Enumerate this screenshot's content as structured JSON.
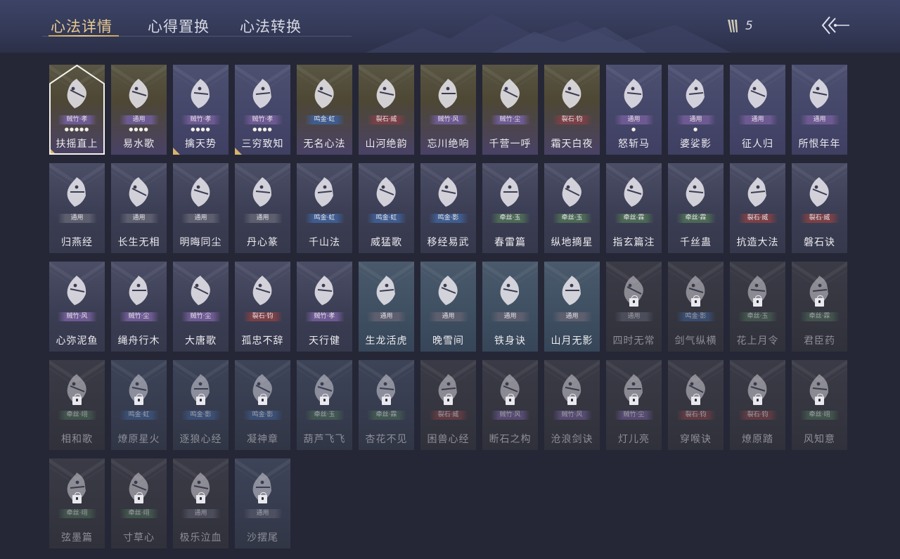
{
  "tabs": [
    {
      "label": "心法详情",
      "active": true
    },
    {
      "label": "心得置换",
      "active": false
    },
    {
      "label": "心法转换",
      "active": false
    }
  ],
  "currency": {
    "icon": "feather-token-icon",
    "value": "5"
  },
  "back_button": {
    "icon": "back-arrow-icon"
  },
  "colors": {
    "active_tab": "#e9c98f",
    "background": "#252737",
    "header": "#3d4366"
  },
  "cards": [
    {
      "name": "扶摇直上",
      "badge": "贼竹·孝",
      "badge_color": "purple",
      "stars": 5,
      "style": "gold",
      "icon": "eagle-icon",
      "selected": true,
      "corner": true
    },
    {
      "name": "易水歌",
      "badge": "通用",
      "badge_color": "purple",
      "stars": 4,
      "style": "gold",
      "icon": "horse-icon"
    },
    {
      "name": "擒天势",
      "badge": "贼竹·孝",
      "badge_color": "purple",
      "stars": 4,
      "style": "purple",
      "icon": "chained-fist-icon",
      "corner": true
    },
    {
      "name": "三穷致知",
      "badge": "贼竹·孝",
      "badge_color": "purple",
      "stars": 4,
      "style": "purple",
      "icon": "scroll-icon",
      "corner": true
    },
    {
      "name": "无名心法",
      "badge": "鸣金·虹",
      "badge_color": "blue",
      "style": "gold",
      "icon": "sword-icon"
    },
    {
      "name": "山河绝韵",
      "badge": "裂石·威",
      "badge_color": "red",
      "style": "gold",
      "icon": "mountains-icon"
    },
    {
      "name": "忘川绝响",
      "badge": "贼竹·风",
      "badge_color": "purple",
      "style": "gold",
      "icon": "mask-icon"
    },
    {
      "name": "千营一呼",
      "badge": "贼竹·尘",
      "badge_color": "purple",
      "style": "gold",
      "icon": "flag-icon"
    },
    {
      "name": "霜天白夜",
      "badge": "裂石·钧",
      "badge_color": "red",
      "style": "gold",
      "icon": "blade-icon"
    },
    {
      "name": "怒斩马",
      "badge": "通用",
      "badge_color": "purple",
      "stars": 1,
      "style": "purple",
      "icon": "crossed-blades-icon"
    },
    {
      "name": "婆娑影",
      "badge": "通用",
      "badge_color": "purple",
      "stars": 1,
      "style": "purple",
      "icon": "dragon-icon"
    },
    {
      "name": "征人归",
      "badge": "通用",
      "badge_color": "purple",
      "style": "purple",
      "icon": "hand-bird-icon"
    },
    {
      "name": "所恨年年",
      "badge": "通用",
      "badge_color": "purple",
      "style": "purple",
      "icon": "bamboo-icon"
    },
    {
      "name": "归燕经",
      "badge": "通用",
      "badge_color": "grey",
      "style": "normal",
      "icon": "swallows-icon"
    },
    {
      "name": "长生无相",
      "badge": "通用",
      "badge_color": "grey",
      "style": "normal",
      "icon": "figure-icon"
    },
    {
      "name": "明晦同尘",
      "badge": "通用",
      "badge_color": "grey",
      "style": "normal",
      "icon": "serpent-icon"
    },
    {
      "name": "丹心篆",
      "badge": "通用",
      "badge_color": "grey",
      "style": "normal",
      "icon": "brush-icon"
    },
    {
      "name": "千山法",
      "badge": "鸣金·虹",
      "badge_color": "blue",
      "style": "normal",
      "icon": "peaks-icon"
    },
    {
      "name": "威猛歌",
      "badge": "鸣金·虹",
      "badge_color": "blue",
      "style": "normal",
      "icon": "prayer-hands-icon"
    },
    {
      "name": "移经易武",
      "badge": "鸣金·影",
      "badge_color": "blue",
      "style": "normal",
      "icon": "armor-icon"
    },
    {
      "name": "春雷篇",
      "badge": "牵丝·玉",
      "badge_color": "green",
      "style": "normal",
      "icon": "storm-tree-icon"
    },
    {
      "name": "纵地摘星",
      "badge": "牵丝·玉",
      "badge_color": "green",
      "style": "normal",
      "icon": "orbit-icon"
    },
    {
      "name": "指玄篇注",
      "badge": "牵丝·霖",
      "badge_color": "green",
      "style": "normal",
      "icon": "yin-yang-icon"
    },
    {
      "name": "千丝蛊",
      "badge": "牵丝·霖",
      "badge_color": "green",
      "style": "normal",
      "icon": "leaf-icon"
    },
    {
      "name": "抗造大法",
      "badge": "裂石·威",
      "badge_color": "red",
      "style": "normal",
      "icon": "bell-icon"
    },
    {
      "name": "磐石诀",
      "badge": "裂石·威",
      "badge_color": "red",
      "style": "normal",
      "icon": "rock-icon"
    },
    {
      "name": "心弥泥鱼",
      "badge": "贼竹·风",
      "badge_color": "purple",
      "style": "normal",
      "icon": "fish-icon"
    },
    {
      "name": "绳舟行木",
      "badge": "贼竹·尘",
      "badge_color": "purple",
      "style": "normal",
      "icon": "roots-icon"
    },
    {
      "name": "大唐歌",
      "badge": "贼竹·尘",
      "badge_color": "purple",
      "style": "normal",
      "icon": "palace-icon"
    },
    {
      "name": "孤忠不辞",
      "badge": "裂石·钧",
      "badge_color": "red",
      "style": "normal",
      "icon": "spear-icon"
    },
    {
      "name": "天行健",
      "badge": "贼竹·孝",
      "badge_color": "purple",
      "style": "normal",
      "icon": "lightning-icon"
    },
    {
      "name": "生龙活虎",
      "badge": "通用",
      "badge_color": "grey",
      "style": "teal",
      "icon": "spiral-cross-icon"
    },
    {
      "name": "晚雪间",
      "badge": "通用",
      "badge_color": "grey",
      "style": "teal",
      "icon": "anchor-cross-icon"
    },
    {
      "name": "铁身诀",
      "badge": "通用",
      "badge_color": "grey",
      "style": "teal",
      "icon": "strongman-icon"
    },
    {
      "name": "山月无影",
      "badge": "通用",
      "badge_color": "grey",
      "style": "teal",
      "icon": "claw-icon"
    },
    {
      "name": "四时无常",
      "badge": "通用",
      "badge_color": "grey",
      "style": "dim",
      "icon": "beast-icon",
      "locked": true
    },
    {
      "name": "剑气纵横",
      "badge": "鸣金·影",
      "badge_color": "blue",
      "style": "dim",
      "icon": "sword-flare-icon",
      "locked": true
    },
    {
      "name": "花上月令",
      "badge": "牵丝·玉",
      "badge_color": "green",
      "style": "dim",
      "icon": "moon-flower-icon",
      "locked": true
    },
    {
      "name": "君臣药",
      "badge": "牵丝·霖",
      "badge_color": "green",
      "style": "dim",
      "icon": "herb-icon",
      "locked": true
    },
    {
      "name": "相和歌",
      "badge": "牵丝·翊",
      "badge_color": "green",
      "style": "dim",
      "icon": "heart-bow-icon",
      "locked": true
    },
    {
      "name": "燎原星火",
      "badge": "鸣金·虹",
      "badge_color": "blue",
      "style": "dimblue",
      "icon": "crescent-slash-icon",
      "locked": true
    },
    {
      "name": "逐狼心经",
      "badge": "鸣金·影",
      "badge_color": "blue",
      "style": "dimblue",
      "icon": "wolf-icon",
      "locked": true
    },
    {
      "name": "凝神章",
      "badge": "鸣金·影",
      "badge_color": "blue",
      "style": "dimblue",
      "icon": "swirl-blade-icon",
      "locked": true
    },
    {
      "name": "葫芦飞飞",
      "badge": "牵丝·玉",
      "badge_color": "green",
      "style": "dimblue",
      "icon": "gourd-icon",
      "locked": true
    },
    {
      "name": "杏花不见",
      "badge": "牵丝·霖",
      "badge_color": "green",
      "style": "dimblue",
      "icon": "blossom-icon",
      "locked": true
    },
    {
      "name": "困兽心经",
      "badge": "裂石·威",
      "badge_color": "red",
      "style": "dim",
      "icon": "cage-icon",
      "locked": true
    },
    {
      "name": "断石之构",
      "badge": "贼竹·风",
      "badge_color": "purple",
      "style": "dim",
      "icon": "warrior-icon",
      "locked": true
    },
    {
      "name": "沧浪剑诀",
      "badge": "贼竹·风",
      "badge_color": "purple",
      "style": "dim",
      "icon": "wave-dragon-icon",
      "locked": true
    },
    {
      "name": "灯儿亮",
      "badge": "贼竹·尘",
      "badge_color": "purple",
      "style": "dim",
      "icon": "lantern-icon",
      "locked": true
    },
    {
      "name": "穿喉诀",
      "badge": "裂石·钧",
      "badge_color": "red",
      "style": "dim",
      "icon": "skull-icon",
      "locked": true
    },
    {
      "name": "燎原踏",
      "badge": "裂石·钧",
      "badge_color": "red",
      "style": "dim",
      "icon": "stomp-icon",
      "locked": true
    },
    {
      "name": "风知意",
      "badge": "牵丝·翊",
      "badge_color": "green",
      "style": "dim",
      "icon": "fan-icon",
      "locked": true
    },
    {
      "name": "弦墨篇",
      "badge": "牵丝·翊",
      "badge_color": "green",
      "style": "dim",
      "icon": "zither-icon",
      "locked": true
    },
    {
      "name": "寸草心",
      "badge": "牵丝·翊",
      "badge_color": "green",
      "style": "dim",
      "icon": "pear-icon",
      "locked": true
    },
    {
      "name": "极乐泣血",
      "badge": "通用",
      "badge_color": "grey",
      "style": "dim",
      "icon": "wings-icon",
      "locked": true
    },
    {
      "name": "沙摆尾",
      "badge": "通用",
      "badge_color": "grey",
      "style": "dimblue",
      "icon": "scorpion-tail-icon",
      "locked": true
    }
  ]
}
